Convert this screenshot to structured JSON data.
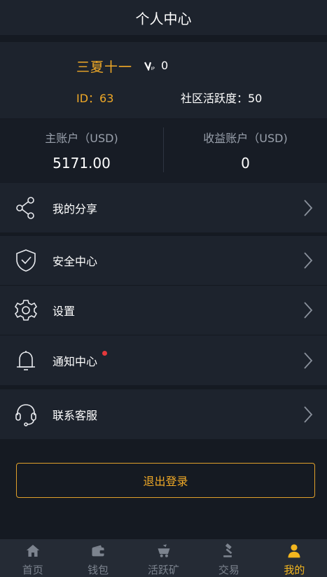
{
  "header": {
    "title": "个人中心"
  },
  "profile": {
    "username": "三夏十一",
    "vip_level": "0",
    "id_text": "ID：63",
    "activity_text": "社区活跃度：50"
  },
  "accounts": {
    "main_label": "主账户（USD)",
    "main_value": "5171.00",
    "income_label": "收益账户（USD)",
    "income_value": "0"
  },
  "menu": {
    "share": "我的分享",
    "security": "安全中心",
    "settings": "设置",
    "notifications": "通知中心",
    "support": "联系客服"
  },
  "logout_label": "退出登录",
  "tabs": [
    {
      "label": "首页",
      "icon": "home-icon"
    },
    {
      "label": "钱包",
      "icon": "wallet-icon"
    },
    {
      "label": "活跃矿",
      "icon": "mining-cart-icon"
    },
    {
      "label": "交易",
      "icon": "gavel-icon"
    },
    {
      "label": "我的",
      "icon": "user-icon"
    }
  ],
  "colors": {
    "accent": "#f0a927",
    "background": "#151a22",
    "card": "#1d232d",
    "notification_dot": "#e5383b"
  }
}
